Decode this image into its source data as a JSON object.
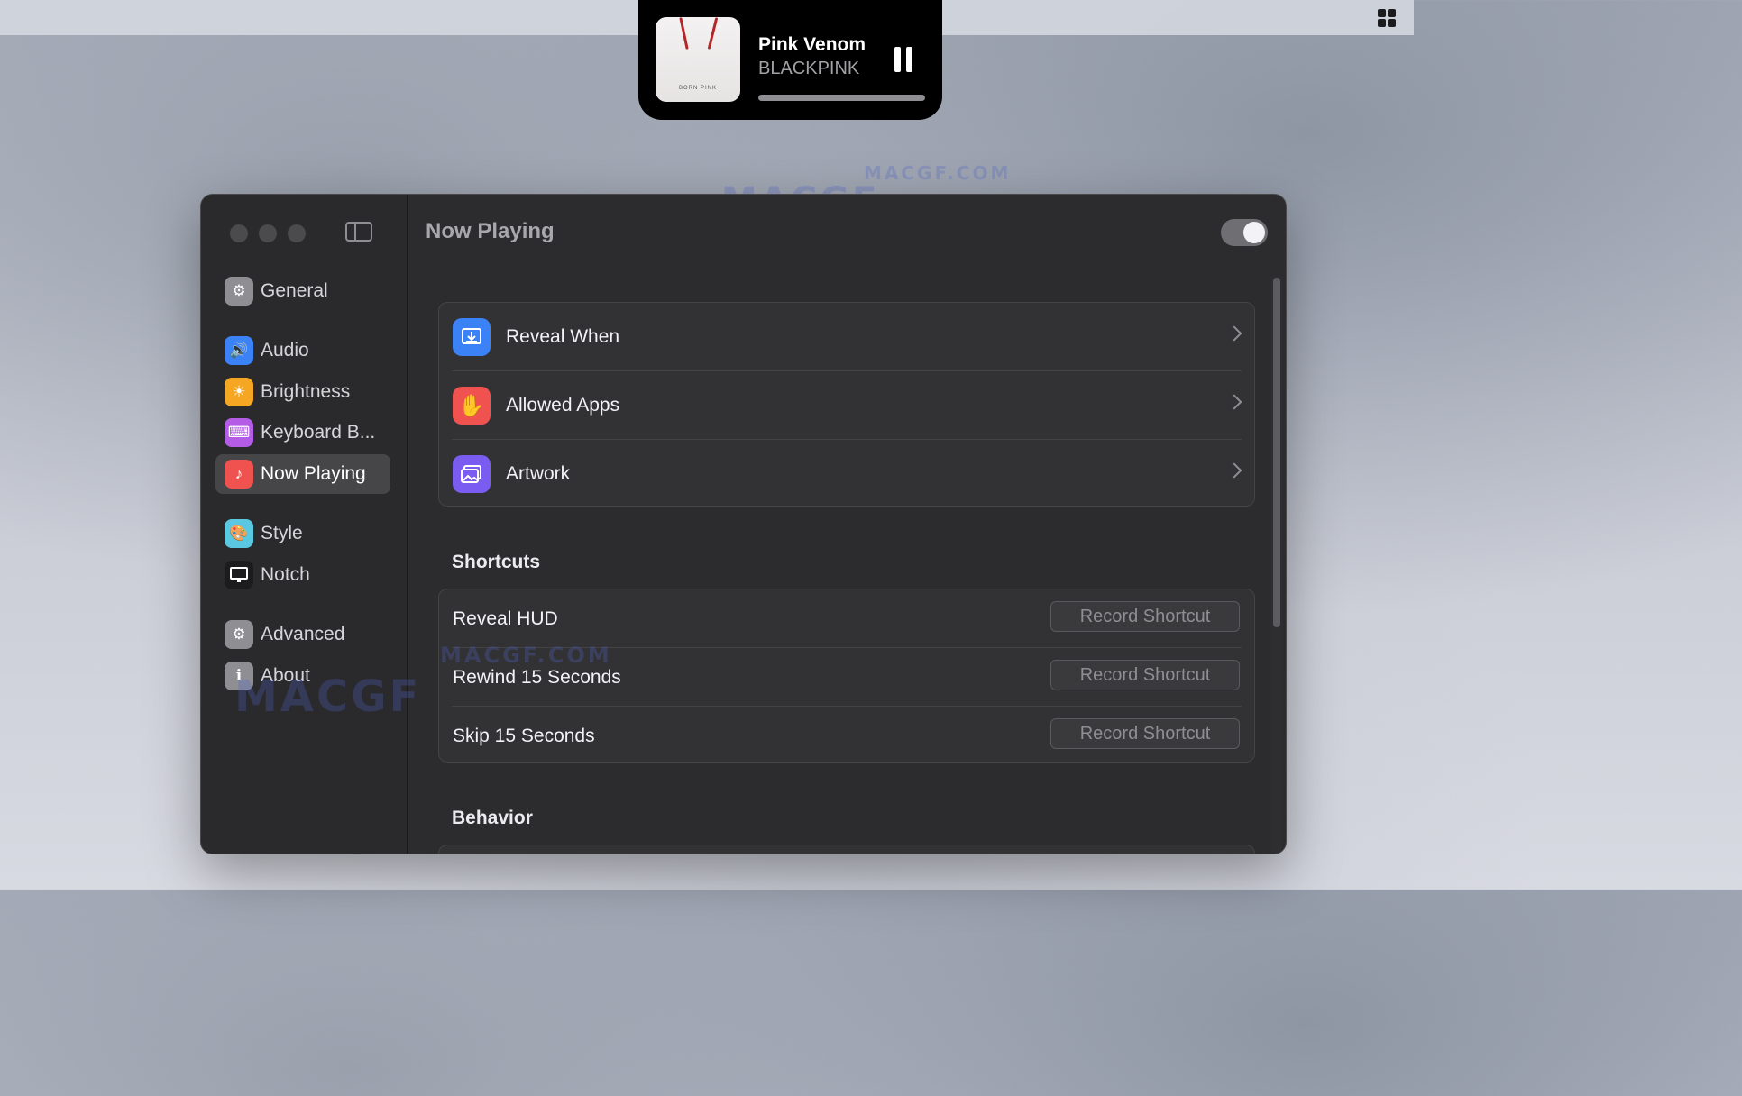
{
  "now_playing_hud": {
    "track_title": "Pink Venom",
    "artist": "BLACKPINK",
    "artwork_text": "BORN PINK",
    "progress": 1.0
  },
  "watermarks": [
    "MACGF.COM",
    "MACGF",
    "MACGF.COM",
    "MACGF"
  ],
  "window": {
    "title": "Now Playing",
    "enabled": true,
    "sidebar": {
      "items": [
        {
          "label": "General",
          "icon": "gear-icon",
          "color": "#8e8e93"
        },
        {
          "label": "Audio",
          "icon": "speaker-icon",
          "color": "#3b82f6"
        },
        {
          "label": "Brightness",
          "icon": "sun-icon",
          "color": "#f5a623"
        },
        {
          "label": "Keyboard B...",
          "icon": "keyboard-icon",
          "color": "#b45ce6"
        },
        {
          "label": "Now Playing",
          "icon": "music-note-icon",
          "color": "#f0524f",
          "selected": true
        },
        {
          "label": "Style",
          "icon": "palette-icon",
          "color": "#5ac8e0"
        },
        {
          "label": "Notch",
          "icon": "display-icon",
          "color": "#1c1c1e"
        },
        {
          "label": "Advanced",
          "icon": "gears-icon",
          "color": "#8e8e93"
        },
        {
          "label": "About",
          "icon": "info-icon",
          "color": "#8e8e93"
        }
      ]
    },
    "settings": {
      "nav_rows": [
        {
          "label": "Reveal When",
          "icon": "download-tray-icon",
          "color": "#3b82f6"
        },
        {
          "label": "Allowed Apps",
          "icon": "hand-icon",
          "color": "#f0524f"
        },
        {
          "label": "Artwork",
          "icon": "photos-icon",
          "color": "#7a5cf0"
        }
      ],
      "shortcuts": {
        "title": "Shortcuts",
        "rows": [
          {
            "label": "Reveal HUD",
            "button": "Record Shortcut"
          },
          {
            "label": "Rewind 15 Seconds",
            "button": "Record Shortcut"
          },
          {
            "label": "Skip 15 Seconds",
            "button": "Record Shortcut"
          }
        ]
      },
      "behavior": {
        "title": "Behavior"
      }
    }
  }
}
